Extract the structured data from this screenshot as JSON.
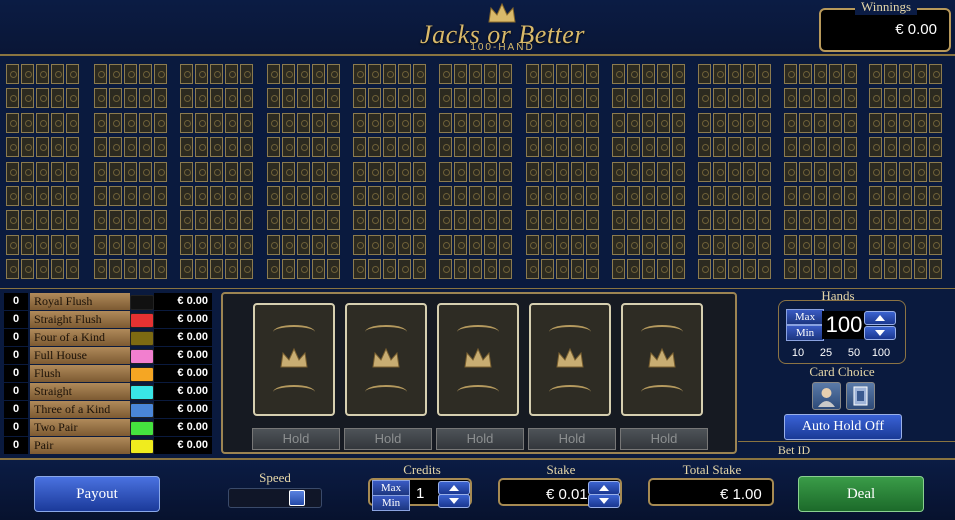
{
  "logo": {
    "title": "Jacks or Better",
    "subtitle": "100-HAND"
  },
  "winnings": {
    "label": "Winnings",
    "value": "€ 0.00"
  },
  "paytable": [
    {
      "count": "0",
      "name": "Royal Flush",
      "color": "#111111",
      "value": "€ 0.00"
    },
    {
      "count": "0",
      "name": "Straight Flush",
      "color": "#e53232",
      "value": "€ 0.00"
    },
    {
      "count": "0",
      "name": "Four of a Kind",
      "color": "#7d6a12",
      "value": "€ 0.00"
    },
    {
      "count": "0",
      "name": "Full House",
      "color": "#f27fcf",
      "value": "€ 0.00"
    },
    {
      "count": "0",
      "name": "Flush",
      "color": "#f5a623",
      "value": "€ 0.00"
    },
    {
      "count": "0",
      "name": "Straight",
      "color": "#39e6e6",
      "value": "€ 0.00"
    },
    {
      "count": "0",
      "name": "Three of a Kind",
      "color": "#4a86d8",
      "value": "€ 0.00"
    },
    {
      "count": "0",
      "name": "Two Pair",
      "color": "#45e33f",
      "value": "€ 0.00"
    },
    {
      "count": "0",
      "name": "Pair",
      "color": "#f0ec1e",
      "value": "€ 0.00"
    }
  ],
  "hold_label": "Hold",
  "hands": {
    "label": "Hands",
    "max_label": "Max",
    "min_label": "Min",
    "value": "100",
    "presets": [
      "10",
      "25",
      "50",
      "100"
    ]
  },
  "card_choice": {
    "label": "Card Choice"
  },
  "auto_hold_label": "Auto Hold Off",
  "bet_id_label": "Bet ID",
  "payout_label": "Payout",
  "speed_label": "Speed",
  "speed_level": 0.75,
  "credits": {
    "label": "Credits",
    "max_label": "Max",
    "min_label": "Min",
    "value": "1"
  },
  "stake": {
    "label": "Stake",
    "value": "€ 0.01"
  },
  "total_stake": {
    "label": "Total Stake",
    "value": "€ 1.00"
  },
  "deal_label": "Deal"
}
